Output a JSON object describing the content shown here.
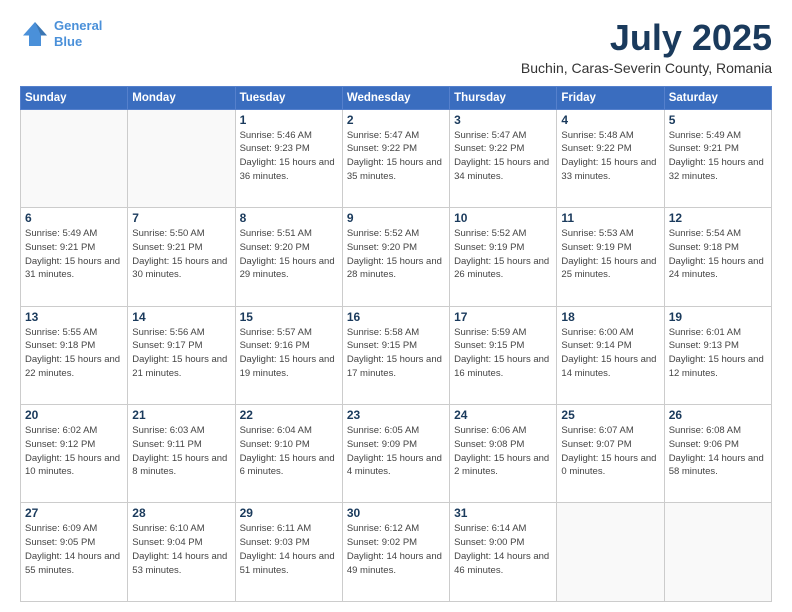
{
  "header": {
    "logo_line1": "General",
    "logo_line2": "Blue",
    "month": "July 2025",
    "location": "Buchin, Caras-Severin County, Romania"
  },
  "days_of_week": [
    "Sunday",
    "Monday",
    "Tuesday",
    "Wednesday",
    "Thursday",
    "Friday",
    "Saturday"
  ],
  "weeks": [
    [
      {
        "day": "",
        "info": ""
      },
      {
        "day": "",
        "info": ""
      },
      {
        "day": "1",
        "info": "Sunrise: 5:46 AM\nSunset: 9:23 PM\nDaylight: 15 hours and 36 minutes."
      },
      {
        "day": "2",
        "info": "Sunrise: 5:47 AM\nSunset: 9:22 PM\nDaylight: 15 hours and 35 minutes."
      },
      {
        "day": "3",
        "info": "Sunrise: 5:47 AM\nSunset: 9:22 PM\nDaylight: 15 hours and 34 minutes."
      },
      {
        "day": "4",
        "info": "Sunrise: 5:48 AM\nSunset: 9:22 PM\nDaylight: 15 hours and 33 minutes."
      },
      {
        "day": "5",
        "info": "Sunrise: 5:49 AM\nSunset: 9:21 PM\nDaylight: 15 hours and 32 minutes."
      }
    ],
    [
      {
        "day": "6",
        "info": "Sunrise: 5:49 AM\nSunset: 9:21 PM\nDaylight: 15 hours and 31 minutes."
      },
      {
        "day": "7",
        "info": "Sunrise: 5:50 AM\nSunset: 9:21 PM\nDaylight: 15 hours and 30 minutes."
      },
      {
        "day": "8",
        "info": "Sunrise: 5:51 AM\nSunset: 9:20 PM\nDaylight: 15 hours and 29 minutes."
      },
      {
        "day": "9",
        "info": "Sunrise: 5:52 AM\nSunset: 9:20 PM\nDaylight: 15 hours and 28 minutes."
      },
      {
        "day": "10",
        "info": "Sunrise: 5:52 AM\nSunset: 9:19 PM\nDaylight: 15 hours and 26 minutes."
      },
      {
        "day": "11",
        "info": "Sunrise: 5:53 AM\nSunset: 9:19 PM\nDaylight: 15 hours and 25 minutes."
      },
      {
        "day": "12",
        "info": "Sunrise: 5:54 AM\nSunset: 9:18 PM\nDaylight: 15 hours and 24 minutes."
      }
    ],
    [
      {
        "day": "13",
        "info": "Sunrise: 5:55 AM\nSunset: 9:18 PM\nDaylight: 15 hours and 22 minutes."
      },
      {
        "day": "14",
        "info": "Sunrise: 5:56 AM\nSunset: 9:17 PM\nDaylight: 15 hours and 21 minutes."
      },
      {
        "day": "15",
        "info": "Sunrise: 5:57 AM\nSunset: 9:16 PM\nDaylight: 15 hours and 19 minutes."
      },
      {
        "day": "16",
        "info": "Sunrise: 5:58 AM\nSunset: 9:15 PM\nDaylight: 15 hours and 17 minutes."
      },
      {
        "day": "17",
        "info": "Sunrise: 5:59 AM\nSunset: 9:15 PM\nDaylight: 15 hours and 16 minutes."
      },
      {
        "day": "18",
        "info": "Sunrise: 6:00 AM\nSunset: 9:14 PM\nDaylight: 15 hours and 14 minutes."
      },
      {
        "day": "19",
        "info": "Sunrise: 6:01 AM\nSunset: 9:13 PM\nDaylight: 15 hours and 12 minutes."
      }
    ],
    [
      {
        "day": "20",
        "info": "Sunrise: 6:02 AM\nSunset: 9:12 PM\nDaylight: 15 hours and 10 minutes."
      },
      {
        "day": "21",
        "info": "Sunrise: 6:03 AM\nSunset: 9:11 PM\nDaylight: 15 hours and 8 minutes."
      },
      {
        "day": "22",
        "info": "Sunrise: 6:04 AM\nSunset: 9:10 PM\nDaylight: 15 hours and 6 minutes."
      },
      {
        "day": "23",
        "info": "Sunrise: 6:05 AM\nSunset: 9:09 PM\nDaylight: 15 hours and 4 minutes."
      },
      {
        "day": "24",
        "info": "Sunrise: 6:06 AM\nSunset: 9:08 PM\nDaylight: 15 hours and 2 minutes."
      },
      {
        "day": "25",
        "info": "Sunrise: 6:07 AM\nSunset: 9:07 PM\nDaylight: 15 hours and 0 minutes."
      },
      {
        "day": "26",
        "info": "Sunrise: 6:08 AM\nSunset: 9:06 PM\nDaylight: 14 hours and 58 minutes."
      }
    ],
    [
      {
        "day": "27",
        "info": "Sunrise: 6:09 AM\nSunset: 9:05 PM\nDaylight: 14 hours and 55 minutes."
      },
      {
        "day": "28",
        "info": "Sunrise: 6:10 AM\nSunset: 9:04 PM\nDaylight: 14 hours and 53 minutes."
      },
      {
        "day": "29",
        "info": "Sunrise: 6:11 AM\nSunset: 9:03 PM\nDaylight: 14 hours and 51 minutes."
      },
      {
        "day": "30",
        "info": "Sunrise: 6:12 AM\nSunset: 9:02 PM\nDaylight: 14 hours and 49 minutes."
      },
      {
        "day": "31",
        "info": "Sunrise: 6:14 AM\nSunset: 9:00 PM\nDaylight: 14 hours and 46 minutes."
      },
      {
        "day": "",
        "info": ""
      },
      {
        "day": "",
        "info": ""
      }
    ]
  ]
}
